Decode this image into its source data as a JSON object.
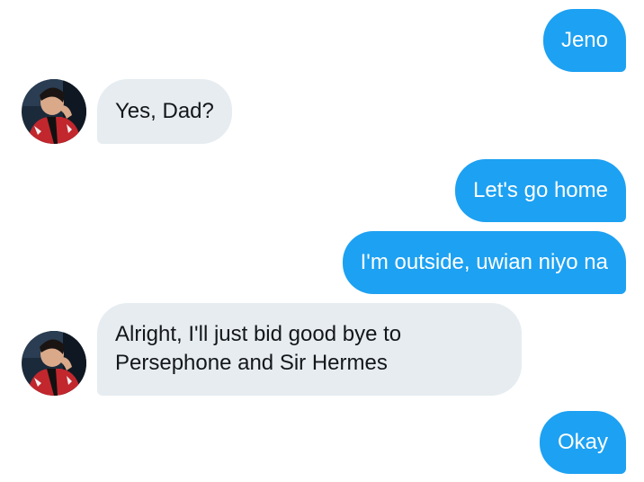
{
  "messages": [
    {
      "from": "me",
      "text": "Jeno"
    },
    {
      "from": "them",
      "text": "Yes, Dad?"
    },
    {
      "from": "me",
      "text": "Let's go home"
    },
    {
      "from": "me",
      "text": "I'm outside, uwian niyo na"
    },
    {
      "from": "them",
      "text": "Alright, I'll just bid good bye to Persephone and Sir Hermes"
    },
    {
      "from": "me",
      "text": "Okay"
    }
  ],
  "colors": {
    "outgoing_bubble": "#1da1f2",
    "incoming_bubble": "#e6ecf0",
    "incoming_text": "#14171a",
    "outgoing_text": "#ffffff"
  },
  "icons": {
    "avatar": "contact-avatar-photo"
  }
}
